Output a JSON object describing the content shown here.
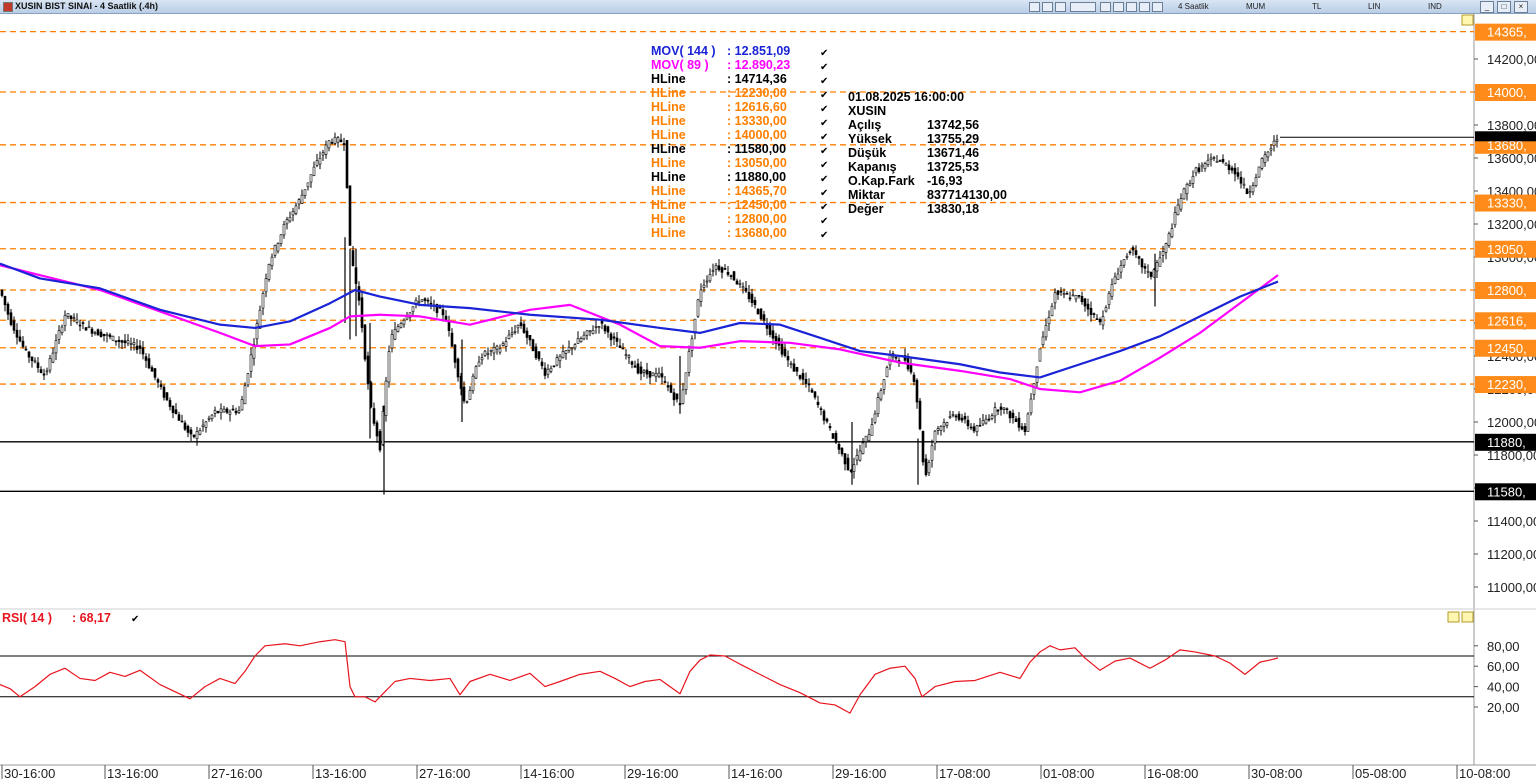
{
  "window": {
    "title": "XUSIN BIST SINAI - 4 Saatlik (.4h)",
    "toolbar": [
      "4 Saatlik",
      "MUM",
      "TL",
      "LIN",
      "IND"
    ],
    "buttons": {
      "minimize": "_",
      "maximize": "□",
      "close": "×"
    }
  },
  "colors": {
    "candle": "#000000",
    "mov144": "#1a23d6",
    "mov89": "#ff00ff",
    "hline_orange": "#ff7f00",
    "hline_black": "#000000",
    "rsi": "#e8141e",
    "axis_label_bg": "#ff8c1a"
  },
  "indicators": [
    {
      "name": "MOV( 144 )",
      "value": ": 12.851,09",
      "color": "#1a23d6"
    },
    {
      "name": "MOV( 89 )",
      "value": ": 12.890,23",
      "color": "#ff00ff"
    },
    {
      "name": "HLine",
      "value": ": 14714,36",
      "color": "#000000"
    },
    {
      "name": "HLine",
      "value": ": 12230,00",
      "color": "#ff7f00"
    },
    {
      "name": "HLine",
      "value": ": 12616,60",
      "color": "#ff7f00"
    },
    {
      "name": "HLine",
      "value": ": 13330,00",
      "color": "#ff7f00"
    },
    {
      "name": "HLine",
      "value": ": 14000,00",
      "color": "#ff7f00"
    },
    {
      "name": "HLine",
      "value": ": 11580,00",
      "color": "#000000"
    },
    {
      "name": "HLine",
      "value": ": 13050,00",
      "color": "#ff7f00"
    },
    {
      "name": "HLine",
      "value": ": 11880,00",
      "color": "#000000"
    },
    {
      "name": "HLine",
      "value": ": 14365,70",
      "color": "#ff7f00"
    },
    {
      "name": "HLine",
      "value": ": 12450,00",
      "color": "#ff7f00"
    },
    {
      "name": "HLine",
      "value": ": 12800,00",
      "color": "#ff7f00"
    },
    {
      "name": "HLine",
      "value": ": 13680,00",
      "color": "#ff7f00"
    }
  ],
  "info_box": {
    "datetime": "01.08.2025  16:00:00",
    "symbol": "XUSIN",
    "rows": [
      {
        "label": "Açılış",
        "value": "13742,56"
      },
      {
        "label": "Yüksek",
        "value": "13755,29"
      },
      {
        "label": "Düşük",
        "value": "13671,46"
      },
      {
        "label": "Kapanış",
        "value": "13725,53"
      },
      {
        "label": "O.Kap.Fark",
        "value": "-16,93"
      },
      {
        "label": "Miktar",
        "value": "837714130,00"
      },
      {
        "label": "Değer",
        "value": "13830,18"
      }
    ]
  },
  "rsi_panel": {
    "label": "RSI( 14 )",
    "value": ": 68,17"
  },
  "chart_data": [
    {
      "type": "candlestick",
      "ylim": [
        10750,
        14550
      ],
      "y_ticks": [
        "14200,00",
        "14000,00",
        "13800,00",
        "13600,00",
        "13400,00",
        "13200,00",
        "13000,00",
        "12800,00",
        "12600,00",
        "12400,00",
        "12200,00",
        "12000,00",
        "11800,00",
        "11600,00",
        "11400,00",
        "11200,00",
        "11000,00"
      ],
      "x_ticks": [
        "30-16:00",
        "13-16:00",
        "27-16:00",
        "13-16:00",
        "27-16:00",
        "14-16:00",
        "29-16:00",
        "14-16:00",
        "29-16:00",
        "17-08:00",
        "01-08:00",
        "16-08:00",
        "30-08:00",
        "05-08:00",
        "10-08:00"
      ],
      "hlines": [
        {
          "value": 14365.7,
          "label": "14365,",
          "color": "#ff7f00",
          "dashed": true
        },
        {
          "value": 14000,
          "label": "14000,",
          "color": "#ff7f00",
          "dashed": true
        },
        {
          "value": 13680,
          "label": "13680,",
          "color": "#ff7f00",
          "dashed": true
        },
        {
          "value": 13330,
          "label": "13330,",
          "color": "#ff7f00",
          "dashed": true
        },
        {
          "value": 13050,
          "label": "13050,",
          "color": "#ff7f00",
          "dashed": true
        },
        {
          "value": 12800,
          "label": "12800,",
          "color": "#ff7f00",
          "dashed": true
        },
        {
          "value": 12616.6,
          "label": "12616,",
          "color": "#ff7f00",
          "dashed": true
        },
        {
          "value": 12450,
          "label": "12450,",
          "color": "#ff7f00",
          "dashed": true
        },
        {
          "value": 12230,
          "label": "12230,",
          "color": "#ff7f00",
          "dashed": true
        },
        {
          "value": 11880,
          "label": "11880,",
          "color": "#000000",
          "dashed": false
        },
        {
          "value": 11580,
          "label": "11580,",
          "color": "#000000",
          "dashed": false
        }
      ],
      "last_price": 13725.53,
      "price_path": [
        [
          0,
          12800
        ],
        [
          10,
          12620
        ],
        [
          25,
          12430
        ],
        [
          45,
          12280
        ],
        [
          65,
          12650
        ],
        [
          90,
          12560
        ],
        [
          115,
          12500
        ],
        [
          140,
          12450
        ],
        [
          165,
          12150
        ],
        [
          192,
          11900
        ],
        [
          215,
          12060
        ],
        [
          240,
          12070
        ],
        [
          255,
          12520
        ],
        [
          268,
          12950
        ],
        [
          285,
          13200
        ],
        [
          300,
          13350
        ],
        [
          315,
          13550
        ],
        [
          330,
          13710
        ],
        [
          345,
          13700
        ],
        [
          350,
          13050
        ],
        [
          360,
          12700
        ],
        [
          370,
          12100
        ],
        [
          380,
          11850
        ],
        [
          390,
          12500
        ],
        [
          400,
          12600
        ],
        [
          420,
          12750
        ],
        [
          445,
          12650
        ],
        [
          465,
          12100
        ],
        [
          480,
          12400
        ],
        [
          500,
          12450
        ],
        [
          520,
          12600
        ],
        [
          545,
          12300
        ],
        [
          570,
          12450
        ],
        [
          600,
          12600
        ],
        [
          620,
          12450
        ],
        [
          640,
          12300
        ],
        [
          660,
          12280
        ],
        [
          680,
          12100
        ],
        [
          700,
          12800
        ],
        [
          715,
          12950
        ],
        [
          730,
          12900
        ],
        [
          750,
          12750
        ],
        [
          770,
          12550
        ],
        [
          790,
          12350
        ],
        [
          810,
          12200
        ],
        [
          830,
          11950
        ],
        [
          850,
          11700
        ],
        [
          870,
          11950
        ],
        [
          890,
          12400
        ],
        [
          905,
          12380
        ],
        [
          915,
          12250
        ],
        [
          925,
          11650
        ],
        [
          935,
          11950
        ],
        [
          955,
          12050
        ],
        [
          975,
          11950
        ],
        [
          1000,
          12100
        ],
        [
          1025,
          11950
        ],
        [
          1040,
          12450
        ],
        [
          1055,
          12780
        ],
        [
          1080,
          12750
        ],
        [
          1100,
          12600
        ],
        [
          1115,
          12880
        ],
        [
          1130,
          13050
        ],
        [
          1150,
          12880
        ],
        [
          1165,
          13050
        ],
        [
          1180,
          13350
        ],
        [
          1195,
          13520
        ],
        [
          1215,
          13600
        ],
        [
          1235,
          13520
        ],
        [
          1248,
          13380
        ],
        [
          1262,
          13580
        ],
        [
          1278,
          13726
        ]
      ],
      "mov144": [
        [
          0,
          12960
        ],
        [
          40,
          12870
        ],
        [
          100,
          12810
        ],
        [
          160,
          12680
        ],
        [
          220,
          12590
        ],
        [
          255,
          12570
        ],
        [
          290,
          12610
        ],
        [
          330,
          12720
        ],
        [
          355,
          12800
        ],
        [
          380,
          12760
        ],
        [
          420,
          12710
        ],
        [
          470,
          12690
        ],
        [
          530,
          12650
        ],
        [
          600,
          12620
        ],
        [
          660,
          12570
        ],
        [
          700,
          12540
        ],
        [
          740,
          12600
        ],
        [
          780,
          12590
        ],
        [
          820,
          12510
        ],
        [
          860,
          12430
        ],
        [
          900,
          12400
        ],
        [
          960,
          12350
        ],
        [
          1000,
          12300
        ],
        [
          1040,
          12270
        ],
        [
          1080,
          12350
        ],
        [
          1120,
          12430
        ],
        [
          1160,
          12520
        ],
        [
          1200,
          12640
        ],
        [
          1240,
          12760
        ],
        [
          1278,
          12851
        ]
      ],
      "mov89": [
        [
          0,
          12950
        ],
        [
          40,
          12890
        ],
        [
          100,
          12800
        ],
        [
          160,
          12670
        ],
        [
          220,
          12540
        ],
        [
          255,
          12460
        ],
        [
          290,
          12470
        ],
        [
          330,
          12570
        ],
        [
          350,
          12640
        ],
        [
          380,
          12650
        ],
        [
          420,
          12640
        ],
        [
          470,
          12590
        ],
        [
          530,
          12680
        ],
        [
          570,
          12710
        ],
        [
          620,
          12590
        ],
        [
          660,
          12460
        ],
        [
          700,
          12450
        ],
        [
          740,
          12490
        ],
        [
          790,
          12480
        ],
        [
          840,
          12440
        ],
        [
          900,
          12360
        ],
        [
          960,
          12310
        ],
        [
          1010,
          12260
        ],
        [
          1040,
          12200
        ],
        [
          1080,
          12180
        ],
        [
          1120,
          12250
        ],
        [
          1160,
          12390
        ],
        [
          1200,
          12540
        ],
        [
          1240,
          12720
        ],
        [
          1278,
          12890
        ]
      ]
    },
    {
      "type": "line",
      "name": "RSI( 14 )",
      "ylim": [
        8,
        95
      ],
      "y_ticks": [
        "80,00",
        "60,00",
        "40,00",
        "20,00"
      ],
      "hlines": [
        70,
        30
      ],
      "last_value": 68.17,
      "path": [
        [
          0,
          42
        ],
        [
          10,
          38
        ],
        [
          20,
          30
        ],
        [
          35,
          40
        ],
        [
          50,
          52
        ],
        [
          65,
          58
        ],
        [
          80,
          48
        ],
        [
          95,
          46
        ],
        [
          110,
          54
        ],
        [
          125,
          50
        ],
        [
          140,
          56
        ],
        [
          160,
          42
        ],
        [
          175,
          35
        ],
        [
          190,
          28
        ],
        [
          205,
          40
        ],
        [
          220,
          48
        ],
        [
          235,
          43
        ],
        [
          245,
          55
        ],
        [
          255,
          70
        ],
        [
          265,
          80
        ],
        [
          285,
          82
        ],
        [
          300,
          80
        ],
        [
          320,
          84
        ],
        [
          335,
          86
        ],
        [
          345,
          84
        ],
        [
          350,
          40
        ],
        [
          355,
          30
        ],
        [
          365,
          30
        ],
        [
          375,
          25
        ],
        [
          385,
          35
        ],
        [
          395,
          45
        ],
        [
          410,
          48
        ],
        [
          430,
          46
        ],
        [
          450,
          48
        ],
        [
          460,
          32
        ],
        [
          470,
          45
        ],
        [
          490,
          52
        ],
        [
          510,
          46
        ],
        [
          530,
          53
        ],
        [
          545,
          40
        ],
        [
          560,
          45
        ],
        [
          580,
          52
        ],
        [
          600,
          55
        ],
        [
          615,
          48
        ],
        [
          630,
          40
        ],
        [
          645,
          45
        ],
        [
          660,
          47
        ],
        [
          680,
          33
        ],
        [
          690,
          55
        ],
        [
          700,
          66
        ],
        [
          710,
          71
        ],
        [
          725,
          70
        ],
        [
          740,
          62
        ],
        [
          760,
          52
        ],
        [
          780,
          42
        ],
        [
          800,
          34
        ],
        [
          820,
          24
        ],
        [
          835,
          22
        ],
        [
          850,
          14
        ],
        [
          860,
          32
        ],
        [
          875,
          52
        ],
        [
          890,
          58
        ],
        [
          905,
          60
        ],
        [
          915,
          48
        ],
        [
          922,
          30
        ],
        [
          935,
          40
        ],
        [
          955,
          45
        ],
        [
          975,
          46
        ],
        [
          1000,
          54
        ],
        [
          1020,
          48
        ],
        [
          1030,
          64
        ],
        [
          1040,
          74
        ],
        [
          1050,
          80
        ],
        [
          1060,
          76
        ],
        [
          1075,
          78
        ],
        [
          1085,
          68
        ],
        [
          1100,
          56
        ],
        [
          1115,
          65
        ],
        [
          1130,
          68
        ],
        [
          1150,
          58
        ],
        [
          1165,
          66
        ],
        [
          1180,
          76
        ],
        [
          1195,
          74
        ],
        [
          1215,
          70
        ],
        [
          1230,
          63
        ],
        [
          1245,
          52
        ],
        [
          1260,
          64
        ],
        [
          1270,
          66
        ],
        [
          1278,
          68.17
        ]
      ]
    }
  ]
}
